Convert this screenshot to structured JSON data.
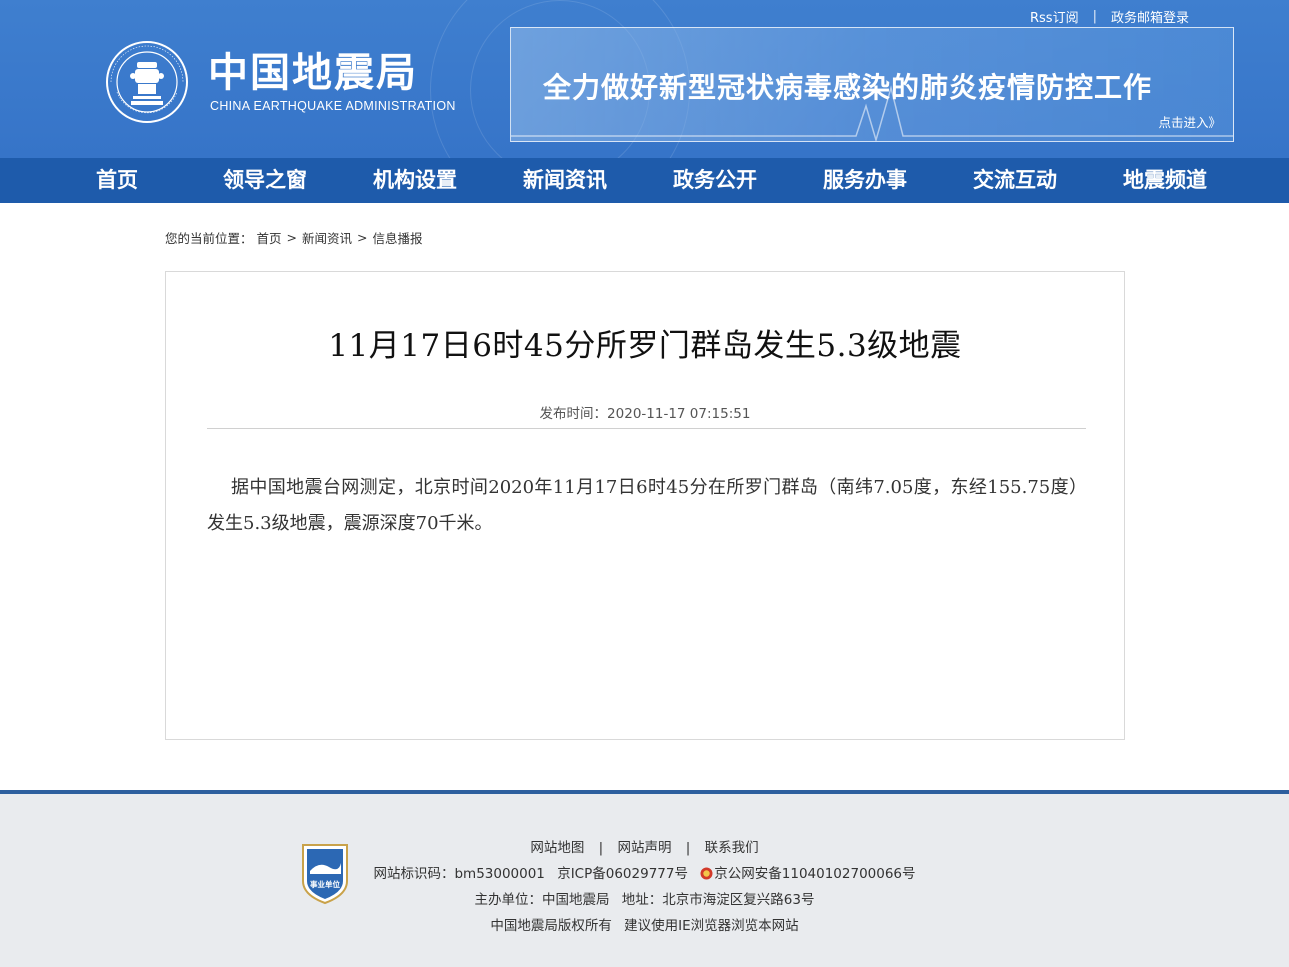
{
  "header": {
    "top_links": [
      "Rss订阅",
      "政务邮箱登录"
    ],
    "brand_cn": "中国地震局",
    "brand_en": "CHINA EARTHQUAKE ADMINISTRATION",
    "banner_title": "全力做好新型冠状病毒感染的肺炎疫情防控工作",
    "banner_more": "点击进入》"
  },
  "nav": {
    "items": [
      "首页",
      "领导之窗",
      "机构设置",
      "新闻资讯",
      "政务公开",
      "服务办事",
      "交流互动",
      "地震频道"
    ]
  },
  "breadcrumb": {
    "prefix": "您的当前位置：",
    "items": [
      "首页",
      "新闻资讯",
      "信息播报"
    ],
    "separator": ">"
  },
  "article": {
    "title": "11月17日6时45分所罗门群岛发生5.3级地震",
    "publish_time": "发布时间：2020-11-17 07:15:51",
    "body": "据中国地震台网测定，北京时间2020年11月17日6时45分在所罗门群岛（南纬7.05度，东经155.75度）发生5.3级地震，震源深度70千米。"
  },
  "footer": {
    "links": [
      "网站地图",
      "网站声明",
      "联系我们"
    ],
    "site_id": "网站标识码：bm53000001",
    "icp": "京ICP备06029777号",
    "police": "京公网安备11040102700066号",
    "sponsor": "主办单位：中国地震局",
    "address": "地址：北京市海淀区复兴路63号",
    "copyright": "中国地震局版权所有",
    "browser_tip": "建议使用IE浏览器浏览本网站",
    "badge_text": "事业单位"
  },
  "colors": {
    "header_blue": "#3674c8",
    "nav_blue": "#1e5bab",
    "footer_bg": "#e9ebee",
    "footer_rule": "#2d5f9e"
  }
}
